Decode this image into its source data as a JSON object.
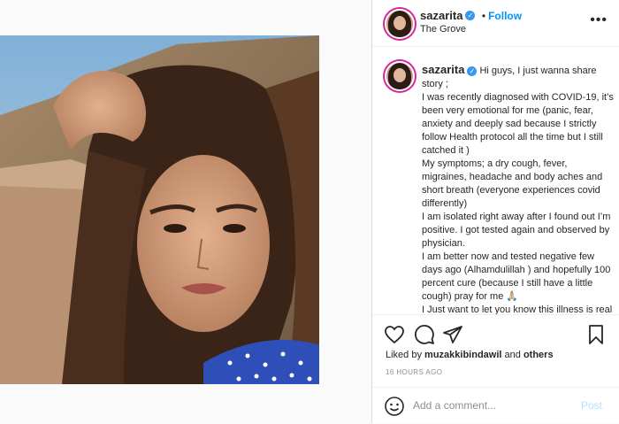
{
  "post": {
    "username": "sazarita",
    "follow_label": "Follow",
    "location": "The Grove",
    "caption": "Hi guys, I just wanna share story ;\nI was recently diagnosed with COVID-19, it’s been very emotional for me (panic, fear, anxiety and deeply sad because I strictly follow Health protocol all the time but I still catched it )\nMy symptoms; a dry cough, fever, migraines, headache and body aches and short breath (everyone experiences covid differently)\nI am isolated right away after I found out I’m positive. I got tested again and observed by physician.\nI am better now and tested negative few days ago (Alhamdulillah ) and hopefully 100 percent cure (because I still have a little cough) pray for me 🙏🏼\nI Just want to let you know this illness is real and serious. I want you to be safe",
    "liked_by_prefix": "Liked by",
    "liked_by_user": "muzakkibindawil",
    "liked_by_and": "and",
    "liked_by_others": "others",
    "time": "16 HOURS AGO",
    "comment_placeholder": "Add a comment...",
    "post_label": "Post"
  },
  "icons": [
    "more-icon",
    "verified-icon",
    "heart-icon",
    "comment-icon",
    "share-icon",
    "bookmark-icon",
    "emoji-icon"
  ],
  "colors": {
    "accent": "#0095f6",
    "verified": "#3897f0",
    "muted": "#8e8e8e",
    "post_disabled": "#b2dffc"
  }
}
